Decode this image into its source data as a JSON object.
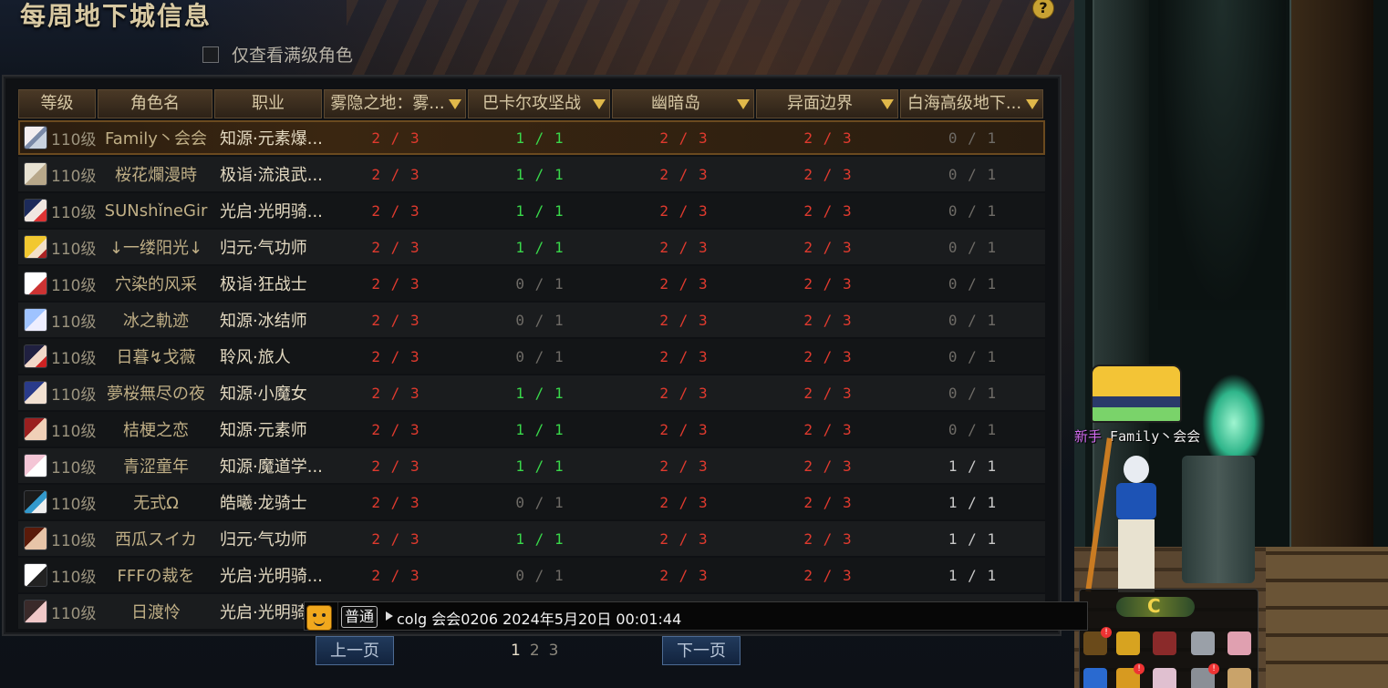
{
  "window": {
    "title": "每周地下城信息",
    "help": "?"
  },
  "filter": {
    "label": "仅查看满级角色",
    "checked": false
  },
  "table": {
    "headers": [
      "等级",
      "角色名",
      "职业",
      "雾隐之地：雾...",
      "巴卡尔攻坚战",
      "幽暗岛",
      "异面边界",
      "白海高级地下..."
    ],
    "rows": [
      {
        "level": "110级",
        "name": "Family丶会会",
        "job": "知源·元素爆...",
        "d": [
          "2 / 3",
          "1 / 1",
          "2 / 3",
          "2 / 3",
          "0 / 1"
        ]
      },
      {
        "level": "110级",
        "name": "桜花爛漫時",
        "job": "极诣·流浪武...",
        "d": [
          "2 / 3",
          "1 / 1",
          "2 / 3",
          "2 / 3",
          "0 / 1"
        ]
      },
      {
        "level": "110级",
        "name": "SUNshǐneGir",
        "job": "光启·光明骑...",
        "d": [
          "2 / 3",
          "1 / 1",
          "2 / 3",
          "2 / 3",
          "0 / 1"
        ]
      },
      {
        "level": "110级",
        "name": "↓一缕阳光↓",
        "job": "归元·气功师",
        "d": [
          "2 / 3",
          "1 / 1",
          "2 / 3",
          "2 / 3",
          "0 / 1"
        ]
      },
      {
        "level": "110级",
        "name": "穴染的风采",
        "job": "极诣·狂战士",
        "d": [
          "2 / 3",
          "0 / 1",
          "2 / 3",
          "2 / 3",
          "0 / 1"
        ]
      },
      {
        "level": "110级",
        "name": "冰之軌迹",
        "job": "知源·冰结师",
        "d": [
          "2 / 3",
          "0 / 1",
          "2 / 3",
          "2 / 3",
          "0 / 1"
        ]
      },
      {
        "level": "110级",
        "name": "日暮↯戈薇",
        "job": "聆风·旅人",
        "d": [
          "2 / 3",
          "0 / 1",
          "2 / 3",
          "2 / 3",
          "0 / 1"
        ]
      },
      {
        "level": "110级",
        "name": "夢桜無尽の夜",
        "job": "知源·小魔女",
        "d": [
          "2 / 3",
          "1 / 1",
          "2 / 3",
          "2 / 3",
          "0 / 1"
        ]
      },
      {
        "level": "110级",
        "name": "桔梗之恋",
        "job": "知源·元素师",
        "d": [
          "2 / 3",
          "1 / 1",
          "2 / 3",
          "2 / 3",
          "0 / 1"
        ]
      },
      {
        "level": "110级",
        "name": "青涩童年",
        "job": "知源·魔道学...",
        "d": [
          "2 / 3",
          "1 / 1",
          "2 / 3",
          "2 / 3",
          "1 / 1"
        ]
      },
      {
        "level": "110级",
        "name": "无式Ω",
        "job": "皓曦·龙骑士",
        "d": [
          "2 / 3",
          "0 / 1",
          "2 / 3",
          "2 / 3",
          "1 / 1"
        ]
      },
      {
        "level": "110级",
        "name": "西瓜スイカ",
        "job": "归元·气功师",
        "d": [
          "2 / 3",
          "1 / 1",
          "2 / 3",
          "2 / 3",
          "1 / 1"
        ]
      },
      {
        "level": "110级",
        "name": "FFFの裁を",
        "job": "光启·光明骑...",
        "d": [
          "2 / 3",
          "0 / 1",
          "2 / 3",
          "2 / 3",
          "1 / 1"
        ]
      },
      {
        "level": "110级",
        "name": "日渡怜",
        "job": "光启·光明骑",
        "d": [
          "",
          "",
          "",
          "",
          ""
        ]
      }
    ]
  },
  "pagination": {
    "prev": "上一页",
    "next": "下一页",
    "pages": [
      "1",
      "2",
      "3"
    ],
    "current": "1"
  },
  "chat": {
    "channel": "普通",
    "text": "colg 会会0206 2024年5月20日 00:01:44"
  },
  "scene": {
    "character_prefix": "新手",
    "character_name": "Family丶会会",
    "quick_top": "C"
  },
  "colors": {
    "done": "#e03a2e",
    "cleared": "#39d84a",
    "none": "#6e6b66"
  }
}
